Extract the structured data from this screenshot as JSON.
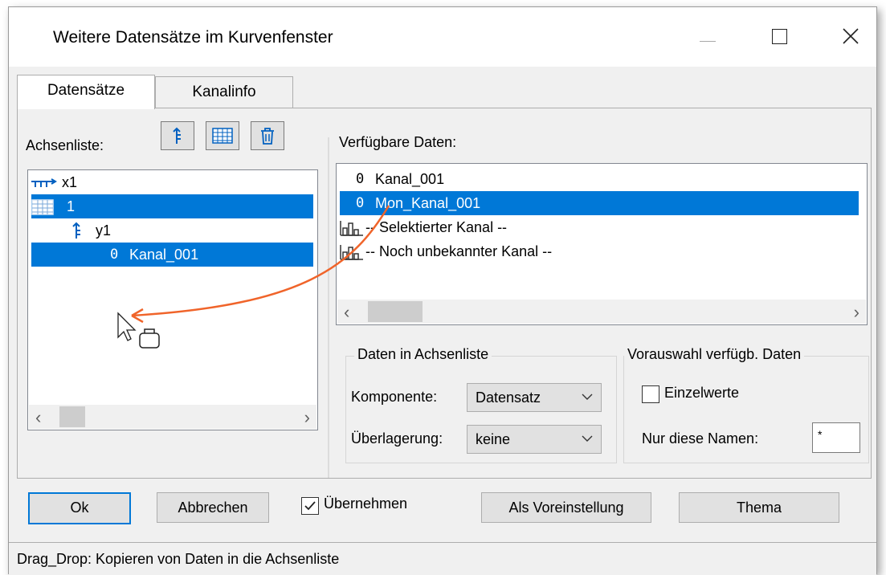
{
  "window": {
    "title": "Weitere Datensätze im Kurvenfenster"
  },
  "tabs": [
    {
      "label": "Datensätze"
    },
    {
      "label": "Kanalinfo"
    }
  ],
  "left": {
    "label": "Achsenliste:",
    "tree": [
      {
        "text": "x1",
        "icon": "x-axis-icon"
      },
      {
        "text": "1",
        "icon": "grid-icon"
      },
      {
        "text": "y1",
        "icon": "y-axis-icon"
      },
      {
        "text": "Kanal_001",
        "icon": "channel-icon"
      }
    ]
  },
  "right": {
    "label": "Verfügbare Daten:",
    "list": [
      {
        "text": "Kanal_001",
        "icon": "channel-icon"
      },
      {
        "text": "Mon_Kanal_001",
        "icon": "channel-icon"
      },
      {
        "text": "-- Selektierter Kanal --",
        "icon": "bar-chart-icon"
      },
      {
        "text": "-- Noch unbekannter Kanal --",
        "icon": "bar-chart-icon"
      }
    ]
  },
  "group_daten": {
    "title": "Daten in Achsenliste",
    "komponente_label": "Komponente:",
    "komponente_value": "Datensatz",
    "ueberlagerung_label": "Überlagerung:",
    "ueberlagerung_value": "keine"
  },
  "group_vorauswahl": {
    "title": "Vorauswahl verfügb. Daten",
    "einzelwerte_label": "Einzelwerte",
    "einzelwerte_checked": false,
    "names_label": "Nur diese Namen:",
    "names_value": "*"
  },
  "buttons": {
    "ok": "Ok",
    "cancel": "Abbrechen",
    "apply_label": "Übernehmen",
    "apply_checked": true,
    "default": "Als Voreinstellung",
    "theme": "Thema"
  },
  "status": "Drag_Drop: Kopieren von Daten in die Achsenliste",
  "colors": {
    "selection": "#0078d7",
    "drag_arrow": "#f0642a"
  }
}
